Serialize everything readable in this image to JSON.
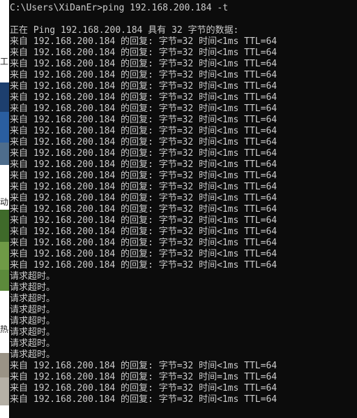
{
  "console": {
    "lines": [
      "C:\\Users\\XiDanEr>ping 192.168.200.184 -t",
      "",
      "正在 Ping 192.168.200.184 具有 32 字节的数据:",
      "来自 192.168.200.184 的回复: 字节=32 时间<1ms TTL=64",
      "来自 192.168.200.184 的回复: 字节=32 时间<1ms TTL=64",
      "来自 192.168.200.184 的回复: 字节=32 时间<1ms TTL=64",
      "来自 192.168.200.184 的回复: 字节=32 时间<1ms TTL=64",
      "来自 192.168.200.184 的回复: 字节=32 时间<1ms TTL=64",
      "来自 192.168.200.184 的回复: 字节=32 时间<1ms TTL=64",
      "来自 192.168.200.184 的回复: 字节=32 时间<1ms TTL=64",
      "来自 192.168.200.184 的回复: 字节=32 时间<1ms TTL=64",
      "来自 192.168.200.184 的回复: 字节=32 时间<1ms TTL=64",
      "来自 192.168.200.184 的回复: 字节=32 时间<1ms TTL=64",
      "来自 192.168.200.184 的回复: 字节=32 时间<1ms TTL=64",
      "来自 192.168.200.184 的回复: 字节=32 时间<1ms TTL=64",
      "来自 192.168.200.184 的回复: 字节=32 时间<1ms TTL=64",
      "来自 192.168.200.184 的回复: 字节=32 时间<1ms TTL=64",
      "来自 192.168.200.184 的回复: 字节=32 时间<1ms TTL=64",
      "来自 192.168.200.184 的回复: 字节=32 时间<1ms TTL=64",
      "来自 192.168.200.184 的回复: 字节=32 时间<1ms TTL=64",
      "来自 192.168.200.184 的回复: 字节=32 时间<1ms TTL=64",
      "来自 192.168.200.184 的回复: 字节=32 时间<1ms TTL=64",
      "来自 192.168.200.184 的回复: 字节=32 时间<1ms TTL=64",
      "来自 192.168.200.184 的回复: 字节=32 时间<1ms TTL=64",
      "请求超时。",
      "请求超时。",
      "请求超时。",
      "请求超时。",
      "请求超时。",
      "请求超时。",
      "请求超时。",
      "请求超时。",
      "来自 192.168.200.184 的回复: 字节=32 时间<1ms TTL=64",
      "来自 192.168.200.184 的回复: 字节=32 时间=1ms TTL=64",
      "来自 192.168.200.184 的回复: 字节=32 时间<1ms TTL=64",
      "来自 192.168.200.184 的回复: 字节=32 时间<1ms TTL=64"
    ],
    "colors": {
      "background": "#0c0c0c",
      "text": "#cccccc"
    }
  },
  "background_window": {
    "fragments": [
      "工",
      "动",
      "热"
    ]
  }
}
